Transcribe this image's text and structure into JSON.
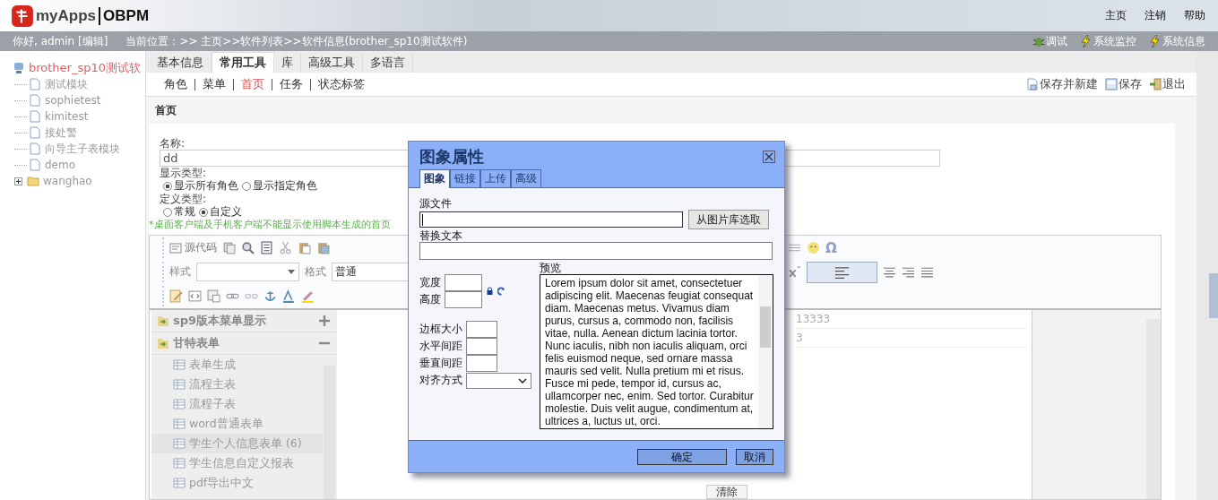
{
  "header": {
    "logo_text": "myApps",
    "product": "OBPM",
    "links": [
      "主页",
      "注销",
      "帮助"
    ]
  },
  "info_bar": {
    "greeting": "你好, admin [编辑]",
    "breadcrumb": "当前位置：>> 主页>>软件列表>>软件信息(brother_sp10测试软件)",
    "tools": [
      {
        "label": "调试",
        "kind": "bug"
      },
      {
        "label": "系统监控",
        "kind": "bolt"
      },
      {
        "label": "系统信息",
        "kind": "bolt"
      }
    ]
  },
  "tree": {
    "root": "brother_sp10测试软",
    "children": [
      {
        "label": "测试模块",
        "kind": "page"
      },
      {
        "label": "sophietest",
        "kind": "page"
      },
      {
        "label": "kimitest",
        "kind": "page"
      },
      {
        "label": "接处警",
        "kind": "page"
      },
      {
        "label": "向导主子表模块",
        "kind": "page"
      },
      {
        "label": "demo",
        "kind": "page"
      },
      {
        "label": "wanghao",
        "kind": "folder",
        "expanded": false
      }
    ]
  },
  "tabs": [
    {
      "label": "基本信息",
      "selected": false
    },
    {
      "label": "常用工具",
      "selected": true
    },
    {
      "label": "库",
      "selected": false
    },
    {
      "label": "高级工具",
      "selected": false
    },
    {
      "label": "多语言",
      "selected": false
    }
  ],
  "sub_nav": [
    {
      "label": "角色",
      "selected": false
    },
    {
      "label": "菜单",
      "selected": false
    },
    {
      "label": "首页",
      "selected": true
    },
    {
      "label": "任务",
      "selected": false
    },
    {
      "label": "状态标签",
      "selected": false
    }
  ],
  "actions": [
    {
      "label": "保存并新建",
      "kind": "save-new"
    },
    {
      "label": "保存",
      "kind": "save"
    },
    {
      "label": "退出",
      "kind": "exit"
    }
  ],
  "section_title": "首页",
  "form": {
    "name_label": "名称:",
    "name_value": "dd",
    "display_type_label": "显示类型:",
    "display_options": [
      {
        "label": "显示所有角色",
        "selected": true
      },
      {
        "label": "显示指定角色",
        "selected": false
      }
    ],
    "define_type_label": "定义类型:",
    "define_options": [
      {
        "label": "常规",
        "selected": false
      },
      {
        "label": "自定义",
        "selected": true
      }
    ],
    "notice": "*桌面客户端及手机客户端不能显示使用脚本生成的首页"
  },
  "editor": {
    "source_label": "源代码",
    "style_label": "样式",
    "format_label": "格式",
    "format_value": "普通",
    "special_char": "Ω"
  },
  "menu_preview": [
    {
      "label": "sp9版本菜单显示",
      "expanded": false
    },
    {
      "label": "甘特表单",
      "expanded": true,
      "children": [
        {
          "label": "表单生成",
          "selected": false
        },
        {
          "label": "流程主表",
          "selected": false
        },
        {
          "label": "流程子表",
          "selected": false
        },
        {
          "label": "word普通表单",
          "selected": false
        },
        {
          "label": "学生个人信息表单 (6)",
          "selected": true
        },
        {
          "label": "学生信息自定义报表",
          "selected": false
        },
        {
          "label": "pdf导出中文",
          "selected": false
        }
      ]
    }
  ],
  "content": {
    "cells": [
      "13333",
      "3"
    ],
    "clear_button": "清除"
  },
  "dialog": {
    "title": "图象属性",
    "tabs": [
      {
        "label": "图象",
        "selected": true
      },
      {
        "label": "链接",
        "selected": false
      },
      {
        "label": "上传",
        "selected": false
      },
      {
        "label": "高级",
        "selected": false
      }
    ],
    "source_label": "源文件",
    "browse_button": "从图片库选取",
    "alt_label": "替换文本",
    "width_label": "宽度",
    "height_label": "高度",
    "border_label": "边框大小",
    "hspace_label": "水平间距",
    "vspace_label": "垂直间距",
    "align_label": "对齐方式",
    "preview_label": "预览",
    "preview_text": "Lorem ipsum dolor sit amet, consectetuer adipiscing elit. Maecenas feugiat consequat diam. Maecenas metus. Vivamus diam purus, cursus a, commodo non, facilisis vitae, nulla. Aenean dictum lacinia tortor. Nunc iaculis, nibh non iaculis aliquam, orci felis euismod neque, sed ornare massa mauris sed velit. Nulla pretium mi et risus. Fusce mi pede, tempor id, cursus ac, ullamcorper nec, enim. Sed tortor. Curabitur molestie. Duis velit augue, condimentum at, ultrices a, luctus ut, orci.",
    "ok_button": "确定",
    "cancel_button": "取消"
  }
}
